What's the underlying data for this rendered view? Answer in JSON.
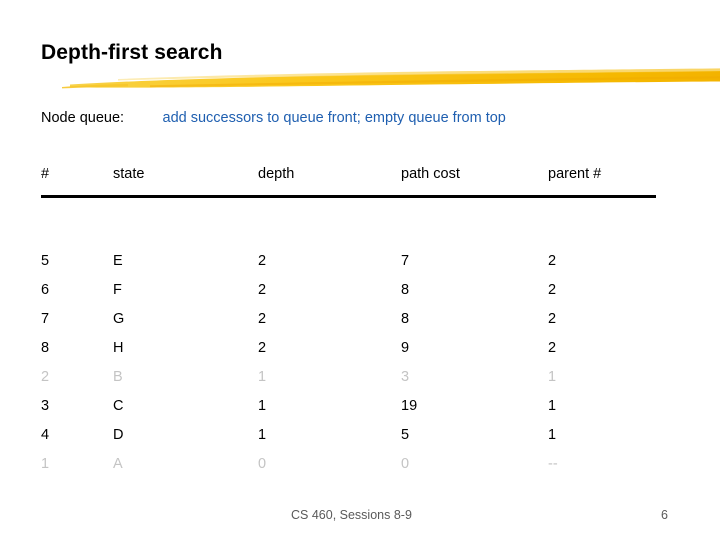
{
  "slide": {
    "title": "Depth-first search",
    "accent_color": "#F2B705",
    "link_color": "#1f5fb0",
    "dim_color": "#c4c4c4"
  },
  "queue": {
    "label": "Node queue:",
    "description": "add successors to queue front; empty queue from top"
  },
  "table": {
    "headers": [
      "#",
      "state",
      "depth",
      "path cost",
      "parent #"
    ],
    "rows": [
      {
        "num": "5",
        "state": "E",
        "depth": "2",
        "path_cost": "7",
        "parent": "2",
        "dim": false
      },
      {
        "num": "6",
        "state": "F",
        "depth": "2",
        "path_cost": "8",
        "parent": "2",
        "dim": false
      },
      {
        "num": "7",
        "state": "G",
        "depth": "2",
        "path_cost": "8",
        "parent": "2",
        "dim": false
      },
      {
        "num": "8",
        "state": "H",
        "depth": "2",
        "path_cost": "9",
        "parent": "2",
        "dim": false
      },
      {
        "num": "2",
        "state": "B",
        "depth": "1",
        "path_cost": "3",
        "parent": "1",
        "dim": true
      },
      {
        "num": "3",
        "state": "C",
        "depth": "1",
        "path_cost": "19",
        "parent": "1",
        "dim": false
      },
      {
        "num": "4",
        "state": "D",
        "depth": "1",
        "path_cost": "5",
        "parent": "1",
        "dim": false
      },
      {
        "num": "1",
        "state": "A",
        "depth": "0",
        "path_cost": "0",
        "parent": "--",
        "dim": true
      }
    ]
  },
  "footer": {
    "course": "CS 460,  Sessions 8-9",
    "page_number": "6"
  }
}
